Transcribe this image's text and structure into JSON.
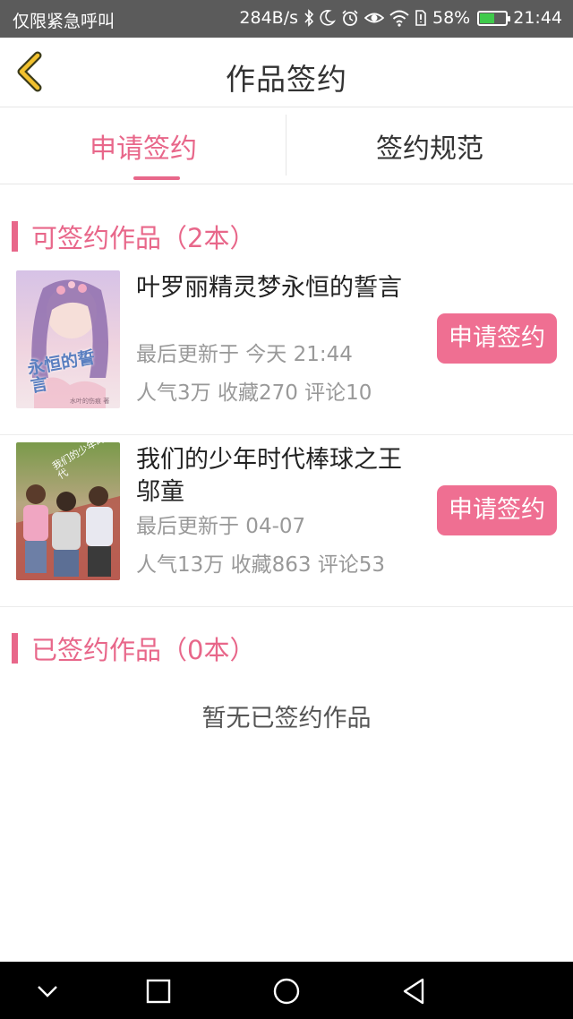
{
  "status_bar": {
    "carrier": "仅限紧急呼叫",
    "speed": "284B/s",
    "battery_percent": "58%",
    "battery_level": 0.58,
    "time": "21:44",
    "icons": [
      "bluetooth-icon",
      "moon-icon",
      "alarm-icon",
      "eye-icon",
      "wifi-icon",
      "sim-icon",
      "battery-icon"
    ]
  },
  "header": {
    "title": "作品签约"
  },
  "tabs": [
    {
      "label": "申请签约",
      "active": true
    },
    {
      "label": "签约规范",
      "active": false
    }
  ],
  "signable": {
    "title": "可签约作品（2本）",
    "books": [
      {
        "name": "叶罗丽精灵梦永恒的誓言",
        "update": "最后更新于 今天 21:44",
        "stats": "人气3万 收藏270 评论10",
        "button": "申请签约",
        "cover_title": "永恒的誓言",
        "cover_author": "水叶的伤痕 著"
      },
      {
        "name": "我们的少年时代棒球之王邬童",
        "update": "最后更新于 04-07",
        "stats": "人气13万 收藏863 评论53",
        "button": "申请签约",
        "cover_title": "我们的少年时代"
      }
    ]
  },
  "signed": {
    "title": "已签约作品（0本）",
    "empty_text": "暂无已签约作品"
  },
  "colors": {
    "accent": "#e8678a",
    "button": "#ef6f92",
    "status_bar": "#5b5b5b"
  }
}
